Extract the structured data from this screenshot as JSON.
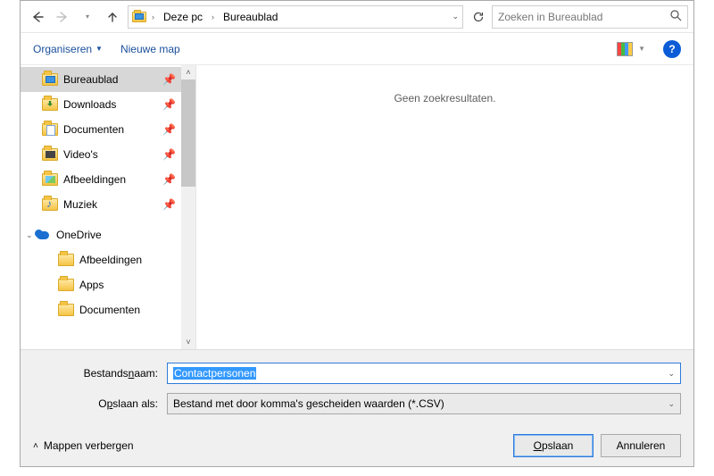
{
  "breadcrumb": {
    "root_label": "Deze pc",
    "current_label": "Bureaublad"
  },
  "search": {
    "placeholder": "Zoeken in Bureaublad"
  },
  "toolbar": {
    "organize": "Organiseren",
    "new_folder": "Nieuwe map"
  },
  "tree": {
    "quick": [
      {
        "key": "desktop",
        "label": "Bureaublad",
        "pinned": true
      },
      {
        "key": "downloads",
        "label": "Downloads",
        "pinned": true
      },
      {
        "key": "documents",
        "label": "Documenten",
        "pinned": true
      },
      {
        "key": "videos",
        "label": "Video's",
        "pinned": true
      },
      {
        "key": "pictures",
        "label": "Afbeeldingen",
        "pinned": true
      },
      {
        "key": "music",
        "label": "Muziek",
        "pinned": true
      }
    ],
    "onedrive_label": "OneDrive",
    "onedrive_children": [
      {
        "key": "od_pictures",
        "label": "Afbeeldingen"
      },
      {
        "key": "od_apps",
        "label": "Apps"
      },
      {
        "key": "od_documents",
        "label": "Documenten"
      }
    ]
  },
  "content": {
    "no_results": "Geen zoekresultaten."
  },
  "fields": {
    "filename_label_pre": "Bestands",
    "filename_label_ul": "n",
    "filename_label_post": "aam:",
    "filename_value": "Contactpersonen",
    "filetype_label_pre": "O",
    "filetype_label_ul": "p",
    "filetype_label_post": "slaan als:",
    "filetype_value": "Bestand met door komma's gescheiden waarden (*.CSV)"
  },
  "footer": {
    "hide_folders": "Mappen verbergen",
    "save_ul": "O",
    "save_post": "pslaan",
    "cancel": "Annuleren"
  }
}
